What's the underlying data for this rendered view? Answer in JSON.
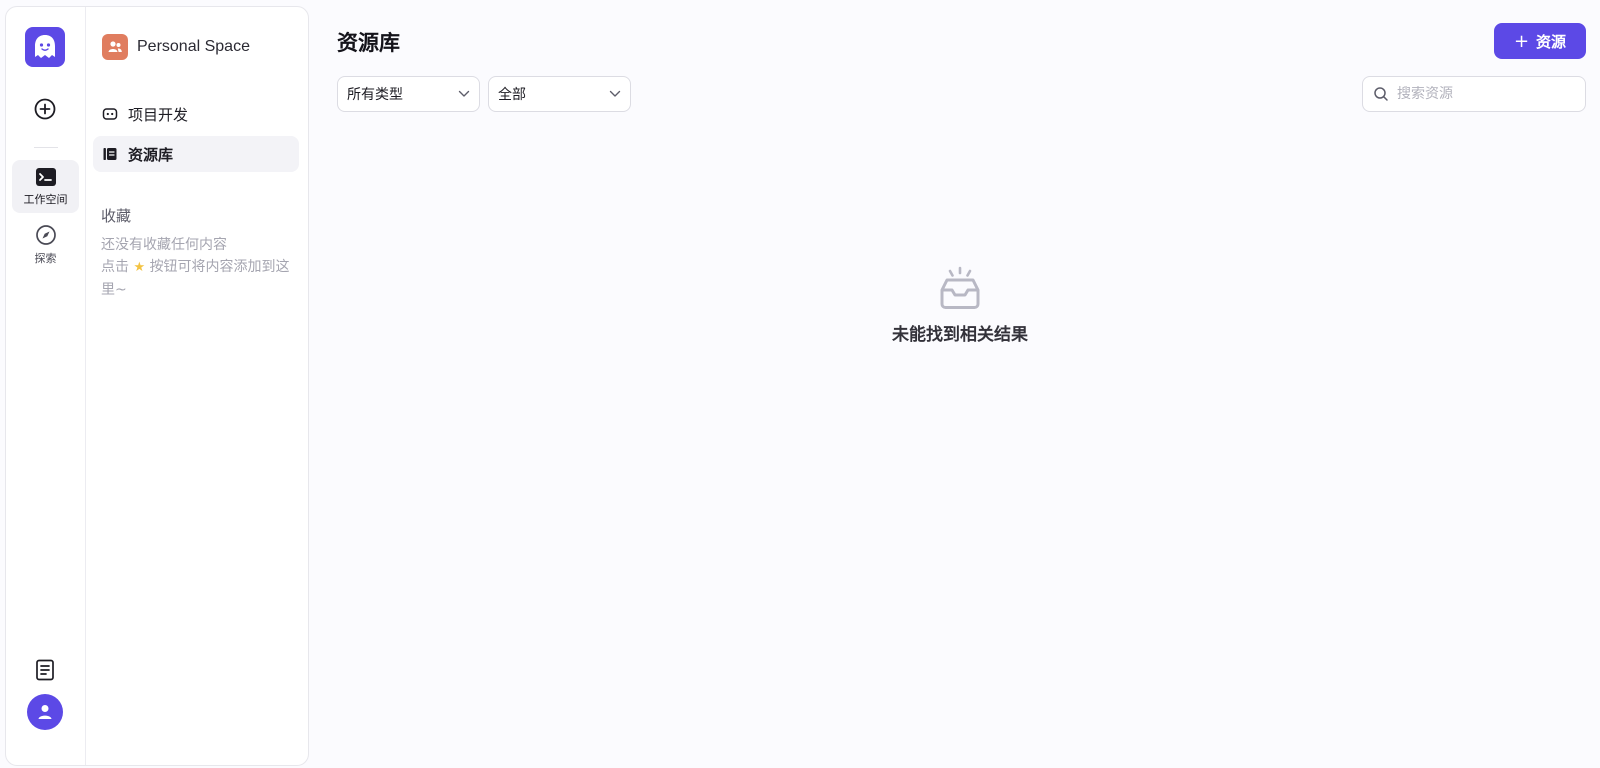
{
  "rail": {
    "workspace_label": "工作空间",
    "explore_label": "探索"
  },
  "space": {
    "name": "Personal Space"
  },
  "nav": {
    "items": [
      {
        "label": "项目开发",
        "icon": "bot-icon"
      },
      {
        "label": "资源库",
        "icon": "library-icon",
        "active": true
      }
    ]
  },
  "favorites": {
    "title": "收藏",
    "empty_line1": "还没有收藏任何内容",
    "empty_line2_prefix": "点击",
    "empty_line2_suffix": "按钮可将内容添加到这里~"
  },
  "main": {
    "title": "资源库",
    "add_button_label": "资源",
    "filter_type": "所有类型",
    "filter_scope": "全部",
    "search_placeholder": "搜索资源",
    "empty_message": "未能找到相关结果"
  },
  "colors": {
    "brand": "#5c49e6",
    "space_icon": "#e07d5f",
    "background": "#fbfbfe"
  }
}
